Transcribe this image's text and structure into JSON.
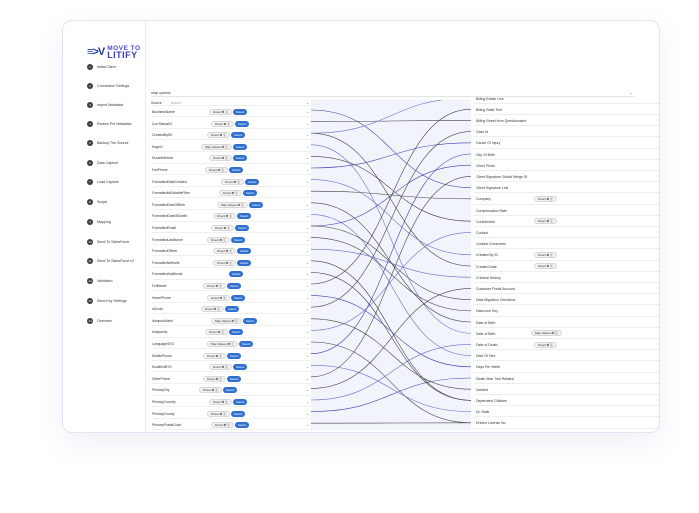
{
  "logo": {
    "mark": "≡>V",
    "line1": "MOVE TO",
    "line2": "LITIFY"
  },
  "steps": [
    {
      "num": "1",
      "label": "Initial Client"
    },
    {
      "num": "2",
      "label": "Connection Settings"
    },
    {
      "num": "3",
      "label": "Import Metadata"
    },
    {
      "num": "4",
      "label": "Review Pre Metadata"
    },
    {
      "num": "5",
      "label": "Backup The Source"
    },
    {
      "num": "6",
      "label": "Data Capture"
    },
    {
      "num": "7",
      "label": "Load Capture"
    },
    {
      "num": "8",
      "label": "Scope"
    },
    {
      "num": "9",
      "label": "Mapping"
    },
    {
      "num": "10",
      "label": "Send To SalesForce"
    },
    {
      "num": "11",
      "label": "Send To SalesForce v2"
    },
    {
      "num": "12",
      "label": "Validation"
    },
    {
      "num": "13",
      "label": "Send Key Settings"
    },
    {
      "num": "14",
      "label": "Overview"
    }
  ],
  "map_options_label": "map options",
  "chevron": "⌄",
  "left_header": {
    "title": "Source",
    "search_placeholder": "search"
  },
  "select_label": "Select",
  "left_rows": [
    {
      "name": "BusinessName",
      "pill": "Direct ⇄ ⓧ"
    },
    {
      "name": "CurrStatusEx",
      "pill": "Direct ⇄ ⓧ"
    },
    {
      "name": "CreatedBySE",
      "pill": "Direct ⇄ ⓧ"
    },
    {
      "name": "Eager1",
      "pill": "Map Values ⇄ ⓧ"
    },
    {
      "name": "DurantMetrics",
      "pill": "Direct ⇄ ⓧ"
    },
    {
      "name": "FaxPhone",
      "pill": "Direct ⇄ ⓧ"
    },
    {
      "name": "FormattedDateCreated",
      "pill": "Direct ⇄ ⓧ"
    },
    {
      "name": "FormattedIsEditableFilter",
      "pill": "Direct ⇄ ⓧ"
    },
    {
      "name": "FormattedDateOfBirth",
      "pill": "Map Values ⇄ ⓧ"
    },
    {
      "name": "FormattedDateOfDeath",
      "pill": "Direct ⇄ ⓧ"
    },
    {
      "name": "FormattedEmail",
      "pill": "Direct ⇄ ⓧ"
    },
    {
      "name": "FormattedLastName",
      "pill": "Direct ⇄ ⓧ"
    },
    {
      "name": "FormattedOfficer",
      "pill": "Direct ⇄ ⓧ"
    },
    {
      "name": "FormattedWebsite",
      "pill": "Direct ⇄ ⓧ"
    },
    {
      "name": "FormattedAdditional",
      "pill": ""
    },
    {
      "name": "FullName",
      "pill": "Direct ⇄ ⓧ"
    },
    {
      "name": "HomePhone",
      "pill": "Direct ⇄ ⓧ"
    },
    {
      "name": "IdCode",
      "pill": "Direct ⇄ ⓧ"
    },
    {
      "name": "IsImportAdmit",
      "pill": "Map Values ⇄ ⓧ"
    },
    {
      "name": "Incapacity",
      "pill": "Direct ⇄ ⓧ"
    },
    {
      "name": "LanguageSEO",
      "pill": "Map Values ⇄ ⓧ"
    },
    {
      "name": "MobilePhone",
      "pill": "Direct ⇄ ⓧ"
    },
    {
      "name": "ModifiedBYS",
      "pill": "Direct ⇄ ⓧ"
    },
    {
      "name": "OtherPhone",
      "pill": "Direct ⇄ ⓧ"
    },
    {
      "name": "PrimaryCity",
      "pill": "Direct ⇄ ⓧ"
    },
    {
      "name": "PrimaryCountry",
      "pill": "Direct ⇄ ⓧ"
    },
    {
      "name": "PrimaryCounty",
      "pill": "Direct ⇄ ⓧ"
    },
    {
      "name": "PrimaryPostalCode",
      "pill": "Direct ⇄ ⓧ"
    }
  ],
  "right_rows": [
    {
      "name": "Billing Estate Line",
      "pill": ""
    },
    {
      "name": "Billing State Text",
      "pill": ""
    },
    {
      "name": "Billing Street from Questionnaire",
      "pill": ""
    },
    {
      "name": "Case Id",
      "pill": ""
    },
    {
      "name": "Cause Of Injury",
      "pill": ""
    },
    {
      "name": "City Of Birth",
      "pill": ""
    },
    {
      "name": "Client Photo",
      "pill": ""
    },
    {
      "name": "Client Signature Global Merge ID",
      "pill": ""
    },
    {
      "name": "Client Signature Link",
      "pill": ""
    },
    {
      "name": "Company",
      "pill": "Direct ⇄ ⓧ"
    },
    {
      "name": "Compensation Rate",
      "pill": ""
    },
    {
      "name": "Confidential",
      "pill": "Direct ⇄ ⓧ"
    },
    {
      "name": "Contact",
      "pill": ""
    },
    {
      "name": "Contact Comments",
      "pill": ""
    },
    {
      "name": "Created By ID",
      "pill": "Direct ⇄ ⓧ"
    },
    {
      "name": "Created Date",
      "pill": "Direct ⇄ ⓧ"
    },
    {
      "name": "Criminal History",
      "pill": ""
    },
    {
      "name": "Customer Portal Account",
      "pill": ""
    },
    {
      "name": "Data Migration Checkbox",
      "pill": ""
    },
    {
      "name": "Data.com Key",
      "pill": ""
    },
    {
      "name": "Date of Birth",
      "pill": ""
    },
    {
      "name": "Date of Birth",
      "pill": "Map Values ⇄ ⓧ"
    },
    {
      "name": "Date of Death",
      "pill": "Direct ⇄ ⓧ"
    },
    {
      "name": "Date Of Hire",
      "pill": ""
    },
    {
      "name": "Days Per Week",
      "pill": ""
    },
    {
      "name": "Death Was Trial Related",
      "pill": ""
    },
    {
      "name": "Deleted",
      "pill": ""
    },
    {
      "name": "Dependent Children",
      "pill": ""
    },
    {
      "name": "DL State",
      "pill": ""
    },
    {
      "name": "Drivers License No",
      "pill": ""
    }
  ]
}
